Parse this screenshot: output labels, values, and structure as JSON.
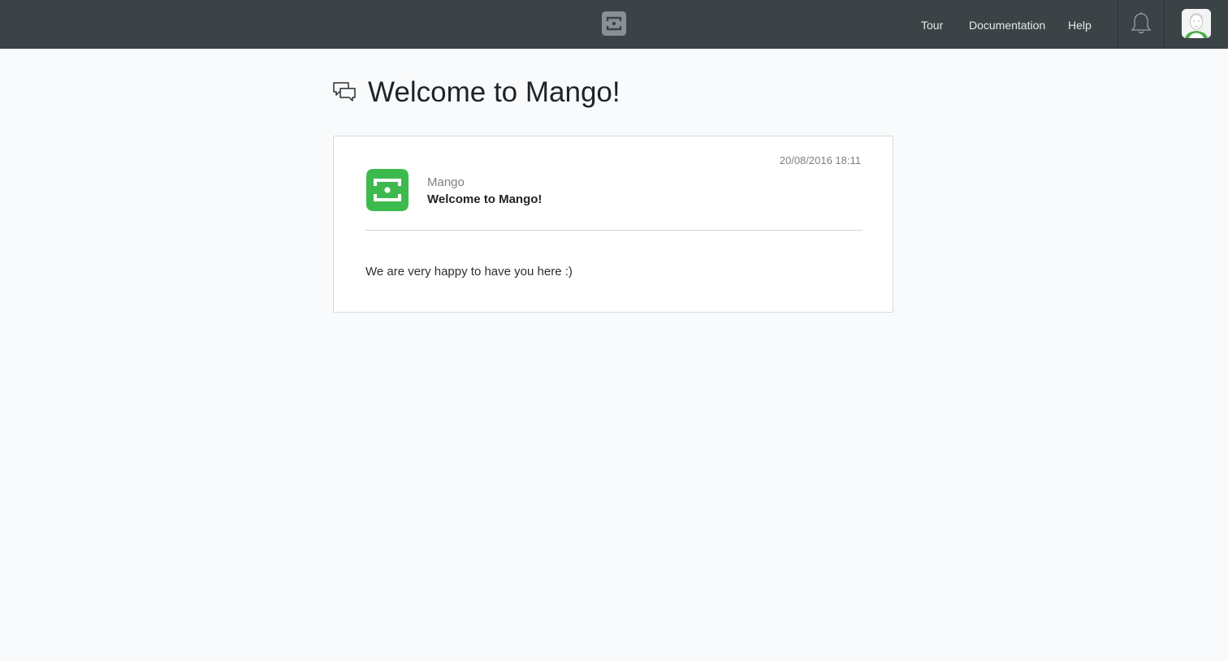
{
  "header": {
    "logo_icon": "mango-logo-icon",
    "nav": [
      {
        "label": "Tour"
      },
      {
        "label": "Documentation"
      },
      {
        "label": "Help"
      }
    ],
    "notifications_icon": "bell-icon",
    "user_avatar_icon": "user-avatar-icon",
    "colors": {
      "bar": "#3c4347",
      "nav_text": "#e6e8ea"
    }
  },
  "page": {
    "title_icon": "chat-bubbles-icon",
    "title": "Welcome to Mango!"
  },
  "message": {
    "timestamp": "20/08/2016 18:11",
    "sender_avatar_icon": "mango-logo-icon",
    "sender": "Mango",
    "subject": "Welcome to Mango!",
    "body": "We are very happy to have you here :)",
    "colors": {
      "brand_green": "#3dba4e"
    }
  }
}
